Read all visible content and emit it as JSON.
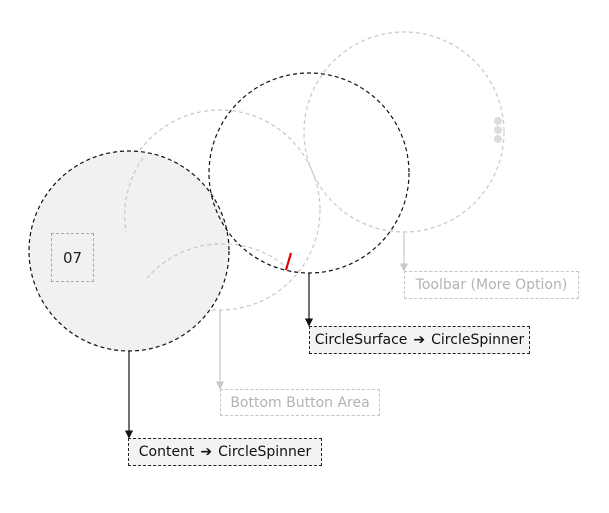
{
  "labels": {
    "content_spinner": {
      "source": "Content",
      "target": "CircleSpinner",
      "arrow": "➔"
    },
    "surface_spinner": {
      "source": "CircleSurface",
      "target": "CircleSpinner",
      "arrow": "➔"
    },
    "bottom_button_area": "Bottom Button Area",
    "toolbar_more_option": "Toolbar (More Option)"
  },
  "content_value": "07",
  "colors": {
    "dark_stroke": "#111111",
    "faint_stroke": "#c8c8c8",
    "filled_circle": "#f1f1f1",
    "indicator": "#e60000",
    "more_dots": "#dcdcdc"
  },
  "icons": {
    "more_option": "vertical-dots-icon",
    "spinner_indicator": "red-tick-indicator"
  }
}
